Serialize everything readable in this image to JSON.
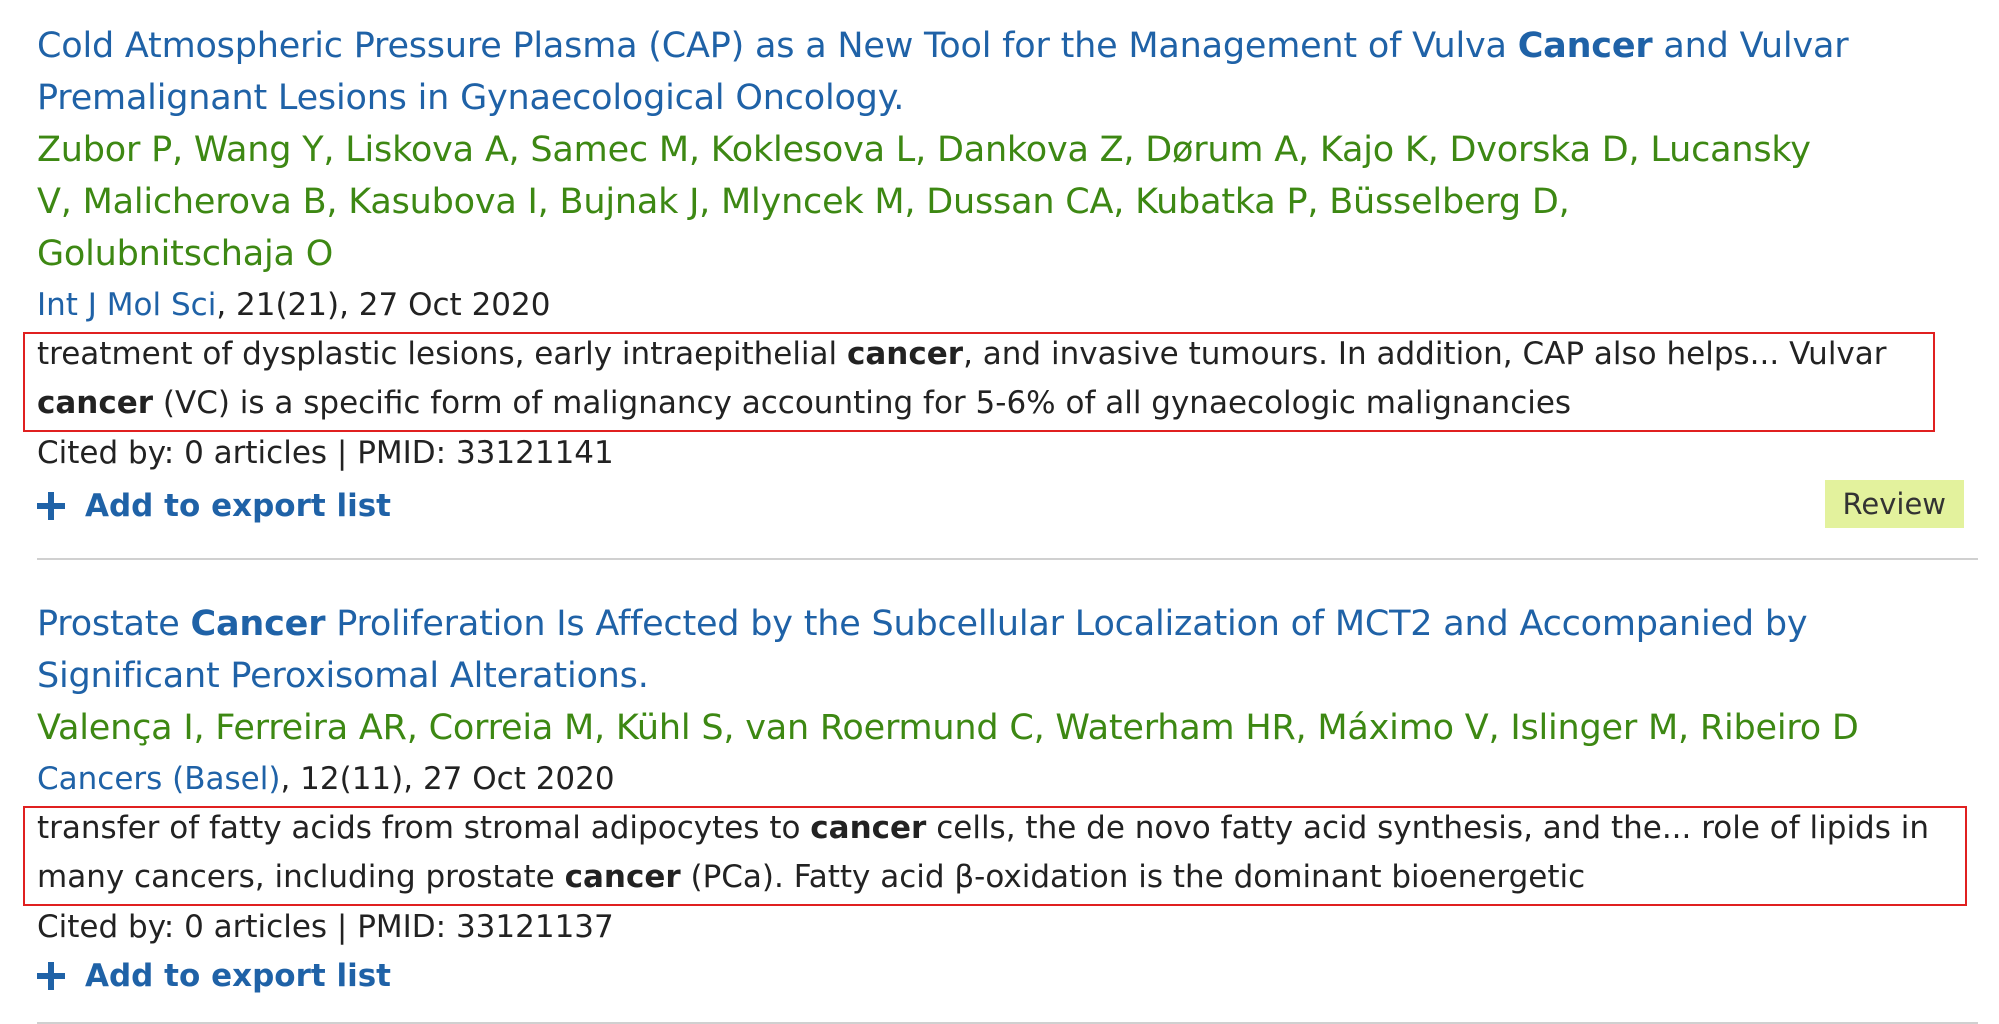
{
  "results": [
    {
      "title_parts": {
        "before": "Cold Atmospheric Pressure Plasma (CAP) as a New Tool for the Management of Vulva ",
        "bold": "Cancer",
        "after": " and Vulvar Premalignant Lesions in Gynaecological Oncology."
      },
      "authors": "Zubor P, Wang Y, Liskova A, Samec M, Koklesova L, Dankova Z, Dørum A, Kajo K, Dvorska D, Lucansky V, Malicherova B, Kasubova I, Bujnak J, Mlyncek M, Dussan CA, Kubatka P, Büsselberg D, Golubnitschaja O",
      "journal": "Int J Mol Sci",
      "citation": ", 21(21), 27 Oct 2020",
      "snippet": {
        "p1": "treatment of dysplastic lesions, early intraepithelial ",
        "b1": "cancer",
        "p2": ", and invasive tumours. In addition, CAP also helps... Vulvar ",
        "b2": "cancer",
        "p3": " (VC) is a specific form of malignancy accounting for 5-6% of all gynaecologic malignancies"
      },
      "cited": "Cited by: 0 articles | PMID: 33121141",
      "export_label": "Add to export list",
      "badge": "Review"
    },
    {
      "title_parts": {
        "before": "Prostate ",
        "bold": "Cancer",
        "after": " Proliferation Is Affected by the Subcellular Localization of MCT2 and Accompanied by Significant Peroxisomal Alterations."
      },
      "authors": "Valença I, Ferreira AR, Correia M, Kühl S, van Roermund C, Waterham HR, Máximo V, Islinger M, Ribeiro D",
      "journal": "Cancers (Basel)",
      "citation": ", 12(11), 27 Oct 2020",
      "snippet": {
        "p1": "transfer of fatty acids from stromal adipocytes to ",
        "b1": "cancer",
        "p2": " cells, the de novo fatty acid synthesis, and the... role of lipids in many cancers, including prostate ",
        "b2": "cancer",
        "p3": " (PCa). Fatty acid β-oxidation is the dominant bioenergetic"
      },
      "cited": "Cited by: 0 articles | PMID: 33121137",
      "export_label": "Add to export list"
    }
  ],
  "colors": {
    "title": "#1f62a7",
    "authors": "#3d8813",
    "highlight_box": "#e02020",
    "badge_bg": "#e3f29d"
  },
  "icons": {
    "export": "plus-icon"
  }
}
